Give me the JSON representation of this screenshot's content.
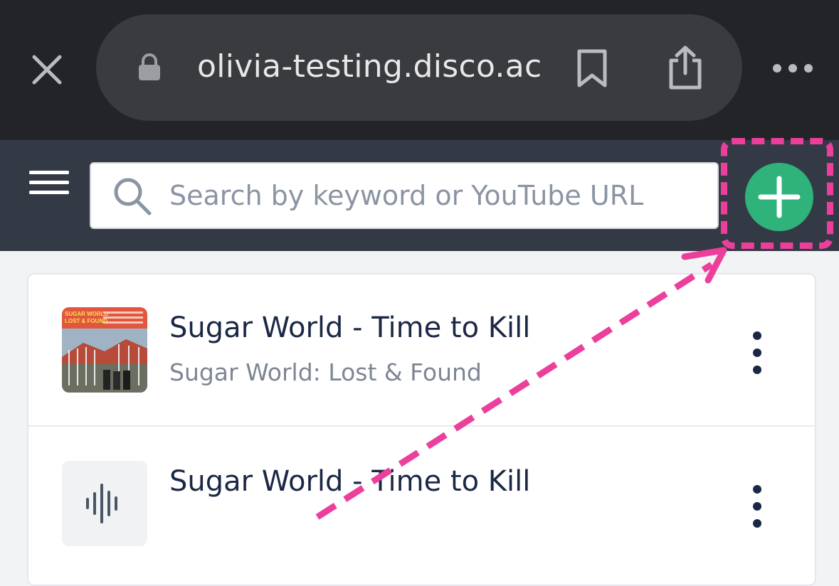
{
  "browser": {
    "url": "olivia-testing.disco.ac",
    "icons": [
      "close-icon",
      "lock-icon",
      "bookmark-icon",
      "share-icon",
      "more-icon"
    ]
  },
  "header": {
    "search_placeholder": "Search by keyword or YouTube URL",
    "icons": [
      "hamburger-menu-icon",
      "search-icon",
      "plus-icon"
    ],
    "accent_color": "#2fb37a"
  },
  "tracks": [
    {
      "title": "Sugar World - Time to Kill",
      "subtitle": "Sugar World: Lost & Found",
      "artwork": {
        "cover_title": "SUGAR WORLD",
        "cover_subtitle": "LOST & FOUND"
      }
    },
    {
      "title": "Sugar World - Time to Kill",
      "subtitle": ""
    }
  ],
  "annotation": {
    "color": "#ec3f9c",
    "style": "dashed"
  }
}
